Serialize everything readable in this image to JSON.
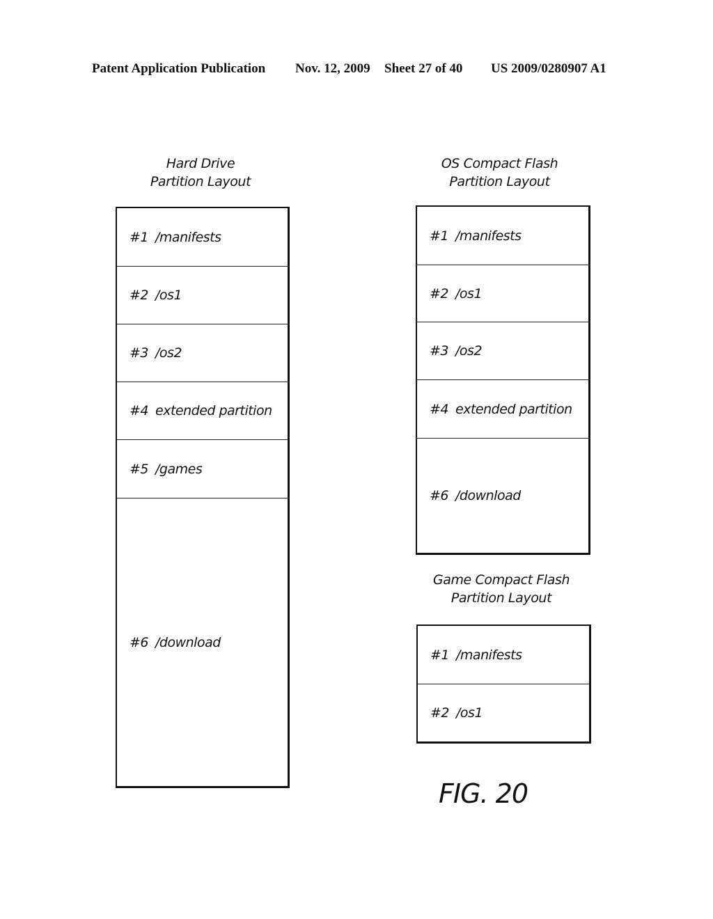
{
  "header": {
    "publication": "Patent Application Publication",
    "date": "Nov. 12, 2009",
    "sheet": "Sheet 27 of 40",
    "patent_number": "US 2009/0280907 A1"
  },
  "diagrams": {
    "hard_drive": {
      "title_line1": "Hard Drive",
      "title_line2": "Partition Layout",
      "partitions": [
        {
          "num": "#1",
          "name": "/manifests"
        },
        {
          "num": "#2",
          "name": "/os1"
        },
        {
          "num": "#3",
          "name": "/os2"
        },
        {
          "num": "#4",
          "name": "extended partition"
        },
        {
          "num": "#5",
          "name": "/games"
        },
        {
          "num": "#6",
          "name": "/download"
        }
      ]
    },
    "os_compact_flash": {
      "title_line1": "OS Compact Flash",
      "title_line2": "Partition Layout",
      "partitions": [
        {
          "num": "#1",
          "name": "/manifests"
        },
        {
          "num": "#2",
          "name": "/os1"
        },
        {
          "num": "#3",
          "name": "/os2"
        },
        {
          "num": "#4",
          "name": "extended partition"
        },
        {
          "num": "#6",
          "name": "/download"
        }
      ]
    },
    "game_compact_flash": {
      "title_line1": "Game Compact Flash",
      "title_line2": "Partition Layout",
      "partitions": [
        {
          "num": "#1",
          "name": "/manifests"
        },
        {
          "num": "#2",
          "name": "/os1"
        }
      ]
    }
  },
  "figure_label": "FIG. 20"
}
